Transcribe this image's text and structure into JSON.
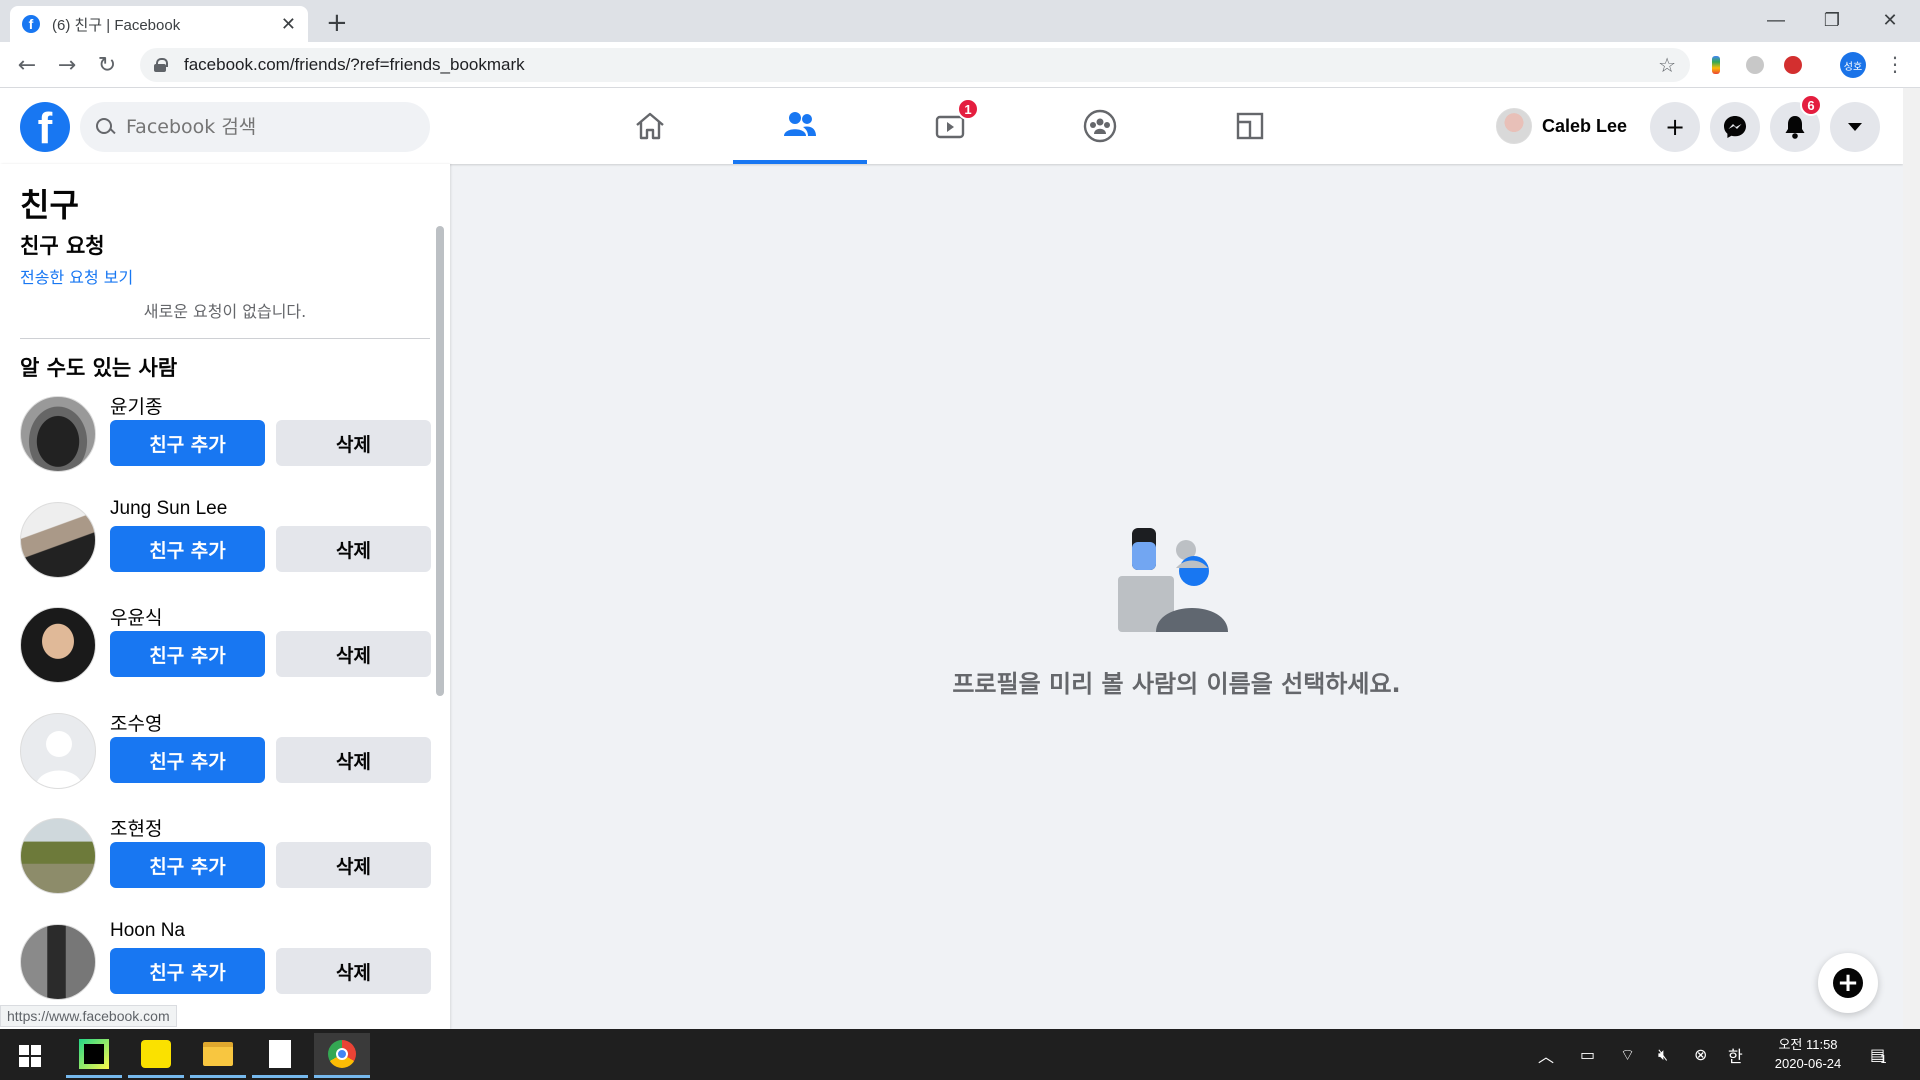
{
  "browser": {
    "tab_title": "(6) 친구 | Facebook",
    "url": "facebook.com/friends/?ref=friends_bookmark",
    "profile_initials": "성호",
    "status_url": "https://www.facebook.com"
  },
  "header": {
    "search_placeholder": "Facebook 검색",
    "user_name": "Caleb Lee",
    "watch_badge": "1",
    "notifications_badge": "6",
    "accent_color": "#1877f2"
  },
  "sidebar": {
    "title": "친구",
    "requests_title": "친구 요청",
    "sent_requests_link": "전송한 요청 보기",
    "no_requests": "새로운 요청이 없습니다.",
    "suggestions_title": "알 수도 있는 사람",
    "add_label": "친구 추가",
    "delete_label": "삭제",
    "people": [
      {
        "name": "윤기종",
        "avatar": "car"
      },
      {
        "name": "Jung Sun Lee",
        "avatar": "piano"
      },
      {
        "name": "우윤식",
        "avatar": "portrait"
      },
      {
        "name": "조수영",
        "avatar": "default"
      },
      {
        "name": "조현정",
        "avatar": "tree"
      },
      {
        "name": "Hoon Na",
        "avatar": "street"
      }
    ]
  },
  "main": {
    "empty_text": "프로필을 미리 볼 사람의 이름을 선택하세요."
  },
  "taskbar": {
    "time_ampm": "오전 11:58",
    "date": "2020-06-24",
    "ime": "한",
    "notification_count": "1"
  }
}
